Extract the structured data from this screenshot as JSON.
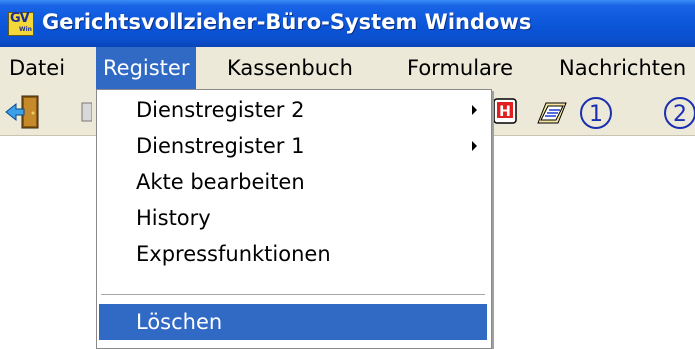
{
  "window": {
    "title": "Gerichtsvollzieher-Büro-System Windows",
    "icon_text": "GV",
    "icon_subtext": "Win"
  },
  "menubar": {
    "items": [
      {
        "label": "Datei"
      },
      {
        "label": "Register"
      },
      {
        "label": "Kassenbuch"
      },
      {
        "label": "Formulare"
      },
      {
        "label": "Nachrichten"
      }
    ],
    "active": "Register"
  },
  "toolbar": {
    "buttons": [
      {
        "icon": "exit-door-icon"
      },
      {
        "icon": "document-icon"
      },
      {
        "icon": "red-h-stamp-icon"
      },
      {
        "icon": "stack-of-documents-icon"
      },
      {
        "icon": "circled-one-icon",
        "text": "①"
      },
      {
        "icon": "circled-two-icon",
        "text": "②"
      }
    ]
  },
  "register_menu": {
    "items": [
      {
        "label": "Dienstregister 2",
        "has_submenu": true
      },
      {
        "label": "Dienstregister 1",
        "has_submenu": true
      },
      {
        "label": "Akte bearbeiten",
        "has_submenu": false
      },
      {
        "label": "History",
        "has_submenu": false
      },
      {
        "label": "Expressfunktionen",
        "has_submenu": false
      },
      {
        "label": "Löschen",
        "has_submenu": false,
        "highlighted": true
      }
    ],
    "highlight_color": "#316ac5"
  }
}
